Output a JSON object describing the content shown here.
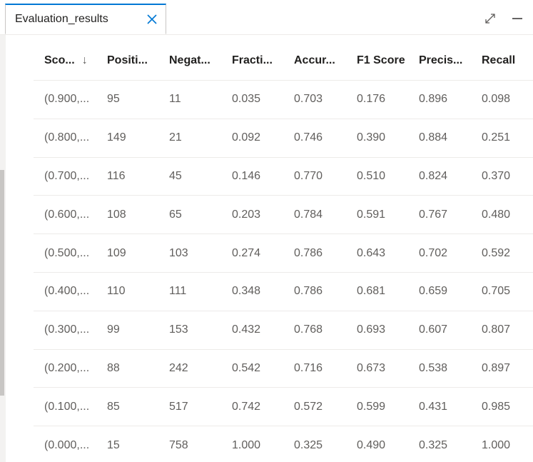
{
  "tab": {
    "title": "Evaluation_results"
  },
  "icons": {
    "close": "close-icon",
    "expand": "expand-icon",
    "minimize": "minimize-icon",
    "sort": "sort-descending-icon"
  },
  "colors": {
    "accent": "#0078d4"
  },
  "table": {
    "columns": [
      "Sco...",
      "Positi...",
      "Negat...",
      "Fracti...",
      "Accur...",
      "F1 Score",
      "Precis...",
      "Recall"
    ],
    "sort_glyph": "↓",
    "rows": [
      [
        "(0.900,...",
        "95",
        "11",
        "0.035",
        "0.703",
        "0.176",
        "0.896",
        "0.098"
      ],
      [
        "(0.800,...",
        "149",
        "21",
        "0.092",
        "0.746",
        "0.390",
        "0.884",
        "0.251"
      ],
      [
        "(0.700,...",
        "116",
        "45",
        "0.146",
        "0.770",
        "0.510",
        "0.824",
        "0.370"
      ],
      [
        "(0.600,...",
        "108",
        "65",
        "0.203",
        "0.784",
        "0.591",
        "0.767",
        "0.480"
      ],
      [
        "(0.500,...",
        "109",
        "103",
        "0.274",
        "0.786",
        "0.643",
        "0.702",
        "0.592"
      ],
      [
        "(0.400,...",
        "110",
        "111",
        "0.348",
        "0.786",
        "0.681",
        "0.659",
        "0.705"
      ],
      [
        "(0.300,...",
        "99",
        "153",
        "0.432",
        "0.768",
        "0.693",
        "0.607",
        "0.807"
      ],
      [
        "(0.200,...",
        "88",
        "242",
        "0.542",
        "0.716",
        "0.673",
        "0.538",
        "0.897"
      ],
      [
        "(0.100,...",
        "85",
        "517",
        "0.742",
        "0.572",
        "0.599",
        "0.431",
        "0.985"
      ],
      [
        "(0.000,...",
        "15",
        "758",
        "1.000",
        "0.325",
        "0.490",
        "0.325",
        "1.000"
      ]
    ]
  }
}
